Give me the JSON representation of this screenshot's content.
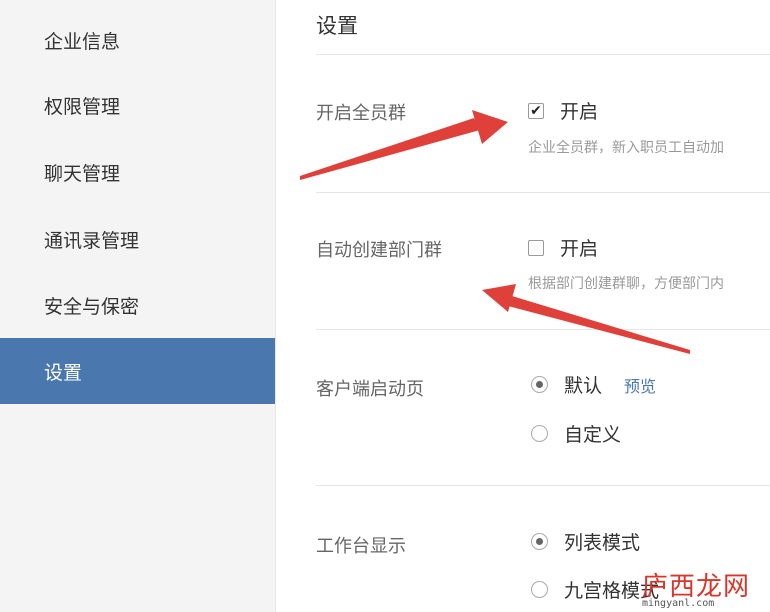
{
  "sidebar": {
    "items": [
      {
        "label": "企业信息",
        "active": false
      },
      {
        "label": "权限管理",
        "active": false
      },
      {
        "label": "聊天管理",
        "active": false
      },
      {
        "label": "通讯录管理",
        "active": false
      },
      {
        "label": "安全与保密",
        "active": false
      },
      {
        "label": "设置",
        "active": true
      }
    ]
  },
  "main": {
    "title": "设置",
    "all_staff_group": {
      "label": "开启全员群",
      "option_label": "开启",
      "checked": true,
      "description": "企业全员群，新入职员工自动加"
    },
    "auto_dept_group": {
      "label": "自动创建部门群",
      "option_label": "开启",
      "checked": false,
      "description": "根据部门创建群聊，方便部门内"
    },
    "client_startup": {
      "label": "客户端启动页",
      "options": [
        {
          "label": "默认",
          "selected": true
        },
        {
          "label": "自定义",
          "selected": false
        }
      ],
      "preview_link": "预览"
    },
    "workbench_display": {
      "label": "工作台显示",
      "options": [
        {
          "label": "列表模式",
          "selected": true
        },
        {
          "label": "九宫格模式",
          "selected": false
        }
      ]
    }
  },
  "annotations": {
    "arrow_color": "#e0403a"
  },
  "watermark": {
    "text": "庐西龙网",
    "url": "mingyanl.com",
    "color": "#d9352b"
  },
  "colors": {
    "sidebar_active": "#4a78ae",
    "link": "#4a78ae"
  }
}
